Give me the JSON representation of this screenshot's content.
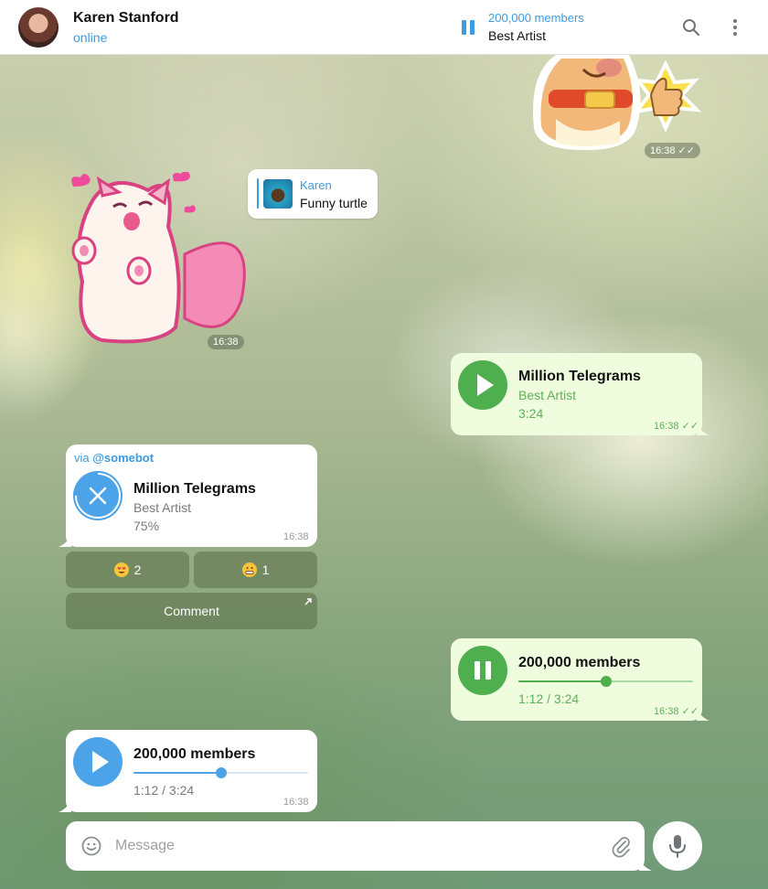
{
  "header": {
    "contact_name": "Karen Stanford",
    "contact_status": "online",
    "pinned_title": "200,000 members",
    "pinned_subtitle": "Best Artist"
  },
  "messages": {
    "sticker_dog": {
      "time": "16:38",
      "status": "read"
    },
    "sticker_cat": {
      "time": "16:38"
    },
    "reply": {
      "name": "Karen",
      "text": "Funny turtle"
    },
    "audio_out_1": {
      "title": "Million Telegrams",
      "artist": "Best Artist",
      "duration": "3:24",
      "time": "16:38",
      "state": "paused"
    },
    "audio_in_1": {
      "via_prefix": "via ",
      "via_bot": "@somebot",
      "title": "Million Telegrams",
      "artist": "Best Artist",
      "progress": "75%",
      "time": "16:38",
      "state": "downloading"
    },
    "reactions": [
      {
        "emoji": "heart-eyes",
        "count": "2"
      },
      {
        "emoji": "grimace",
        "count": "1"
      }
    ],
    "comment_label": "Comment",
    "audio_out_2": {
      "title": "200,000 members",
      "position": "1:12 / 3:24",
      "progress_fraction": 0.5,
      "time": "16:38",
      "state": "playing"
    },
    "audio_in_2": {
      "title": "200,000 members",
      "position": "1:12 / 3:24",
      "progress_fraction": 0.5,
      "time": "16:38",
      "state": "paused"
    }
  },
  "composer": {
    "placeholder": "Message"
  },
  "colors": {
    "accent_blue": "#3d9be0",
    "play_green": "#4fae4e",
    "outgoing_bubble": "#effdde",
    "incoming_bubble": "#ffffff"
  }
}
